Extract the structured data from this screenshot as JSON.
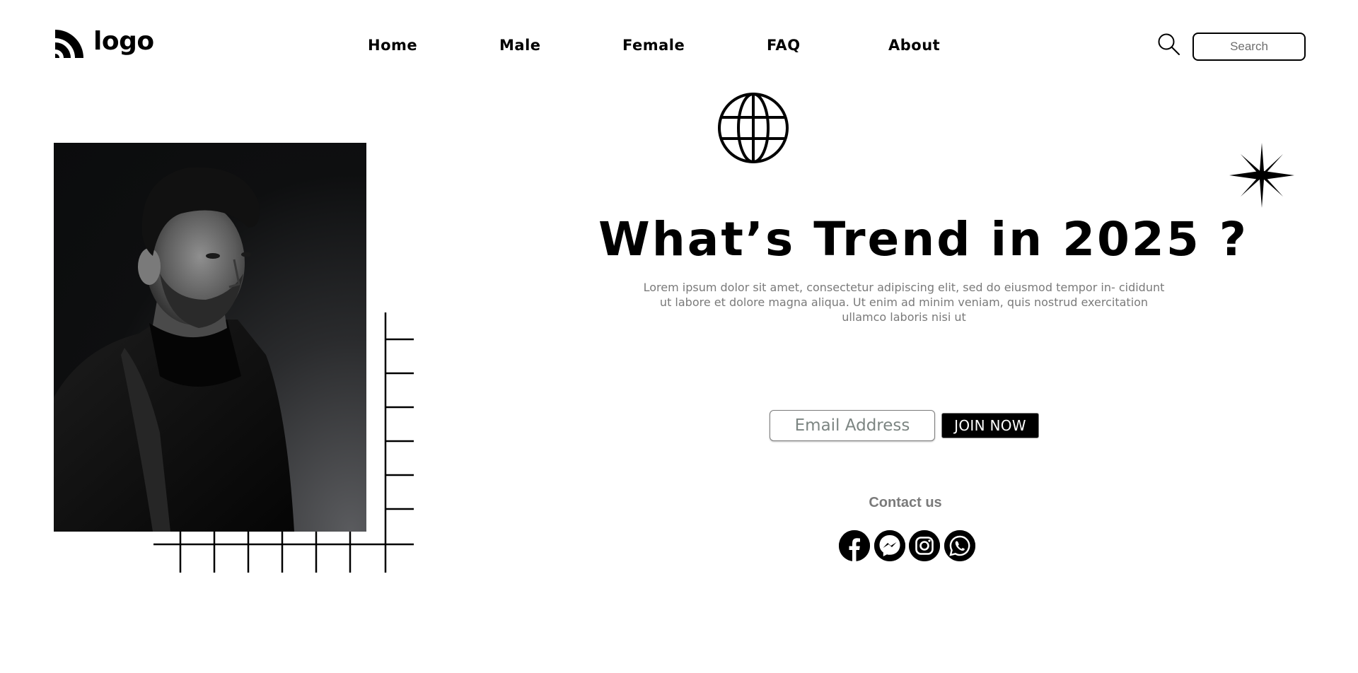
{
  "header": {
    "logo_text": "logo",
    "nav": [
      {
        "label": "Home"
      },
      {
        "label": "Male"
      },
      {
        "label": "Female"
      },
      {
        "label": "FAQ"
      },
      {
        "label": "About"
      }
    ],
    "search": {
      "placeholder": "Search",
      "icon": "search-icon"
    }
  },
  "hero": {
    "image": {
      "description_icon": "portrait-photo",
      "style": "black-and-white"
    },
    "title": "What’s Trend in 2025 ?",
    "description": "Lorem ipsum dolor sit amet, consectetur adipiscing elit, sed do eiusmod tempor in- cididunt ut labore et dolore magna aliqua. Ut enim ad minim veniam, quis nostrud exercitation ullamco laboris nisi ut",
    "decorations": [
      "globe-icon",
      "sparkle-star-icon",
      "grid-lines"
    ]
  },
  "signup": {
    "email_placeholder": "Email Address",
    "button_label": "JOIN NOW"
  },
  "contact": {
    "label": "Contact us",
    "social": [
      "facebook-icon",
      "messenger-icon",
      "instagram-icon",
      "whatsapp-icon"
    ]
  },
  "colors": {
    "text": "#000000",
    "muted": "#7a7a7a",
    "background": "#ffffff",
    "button_bg": "#000000",
    "button_text": "#ffffff"
  }
}
